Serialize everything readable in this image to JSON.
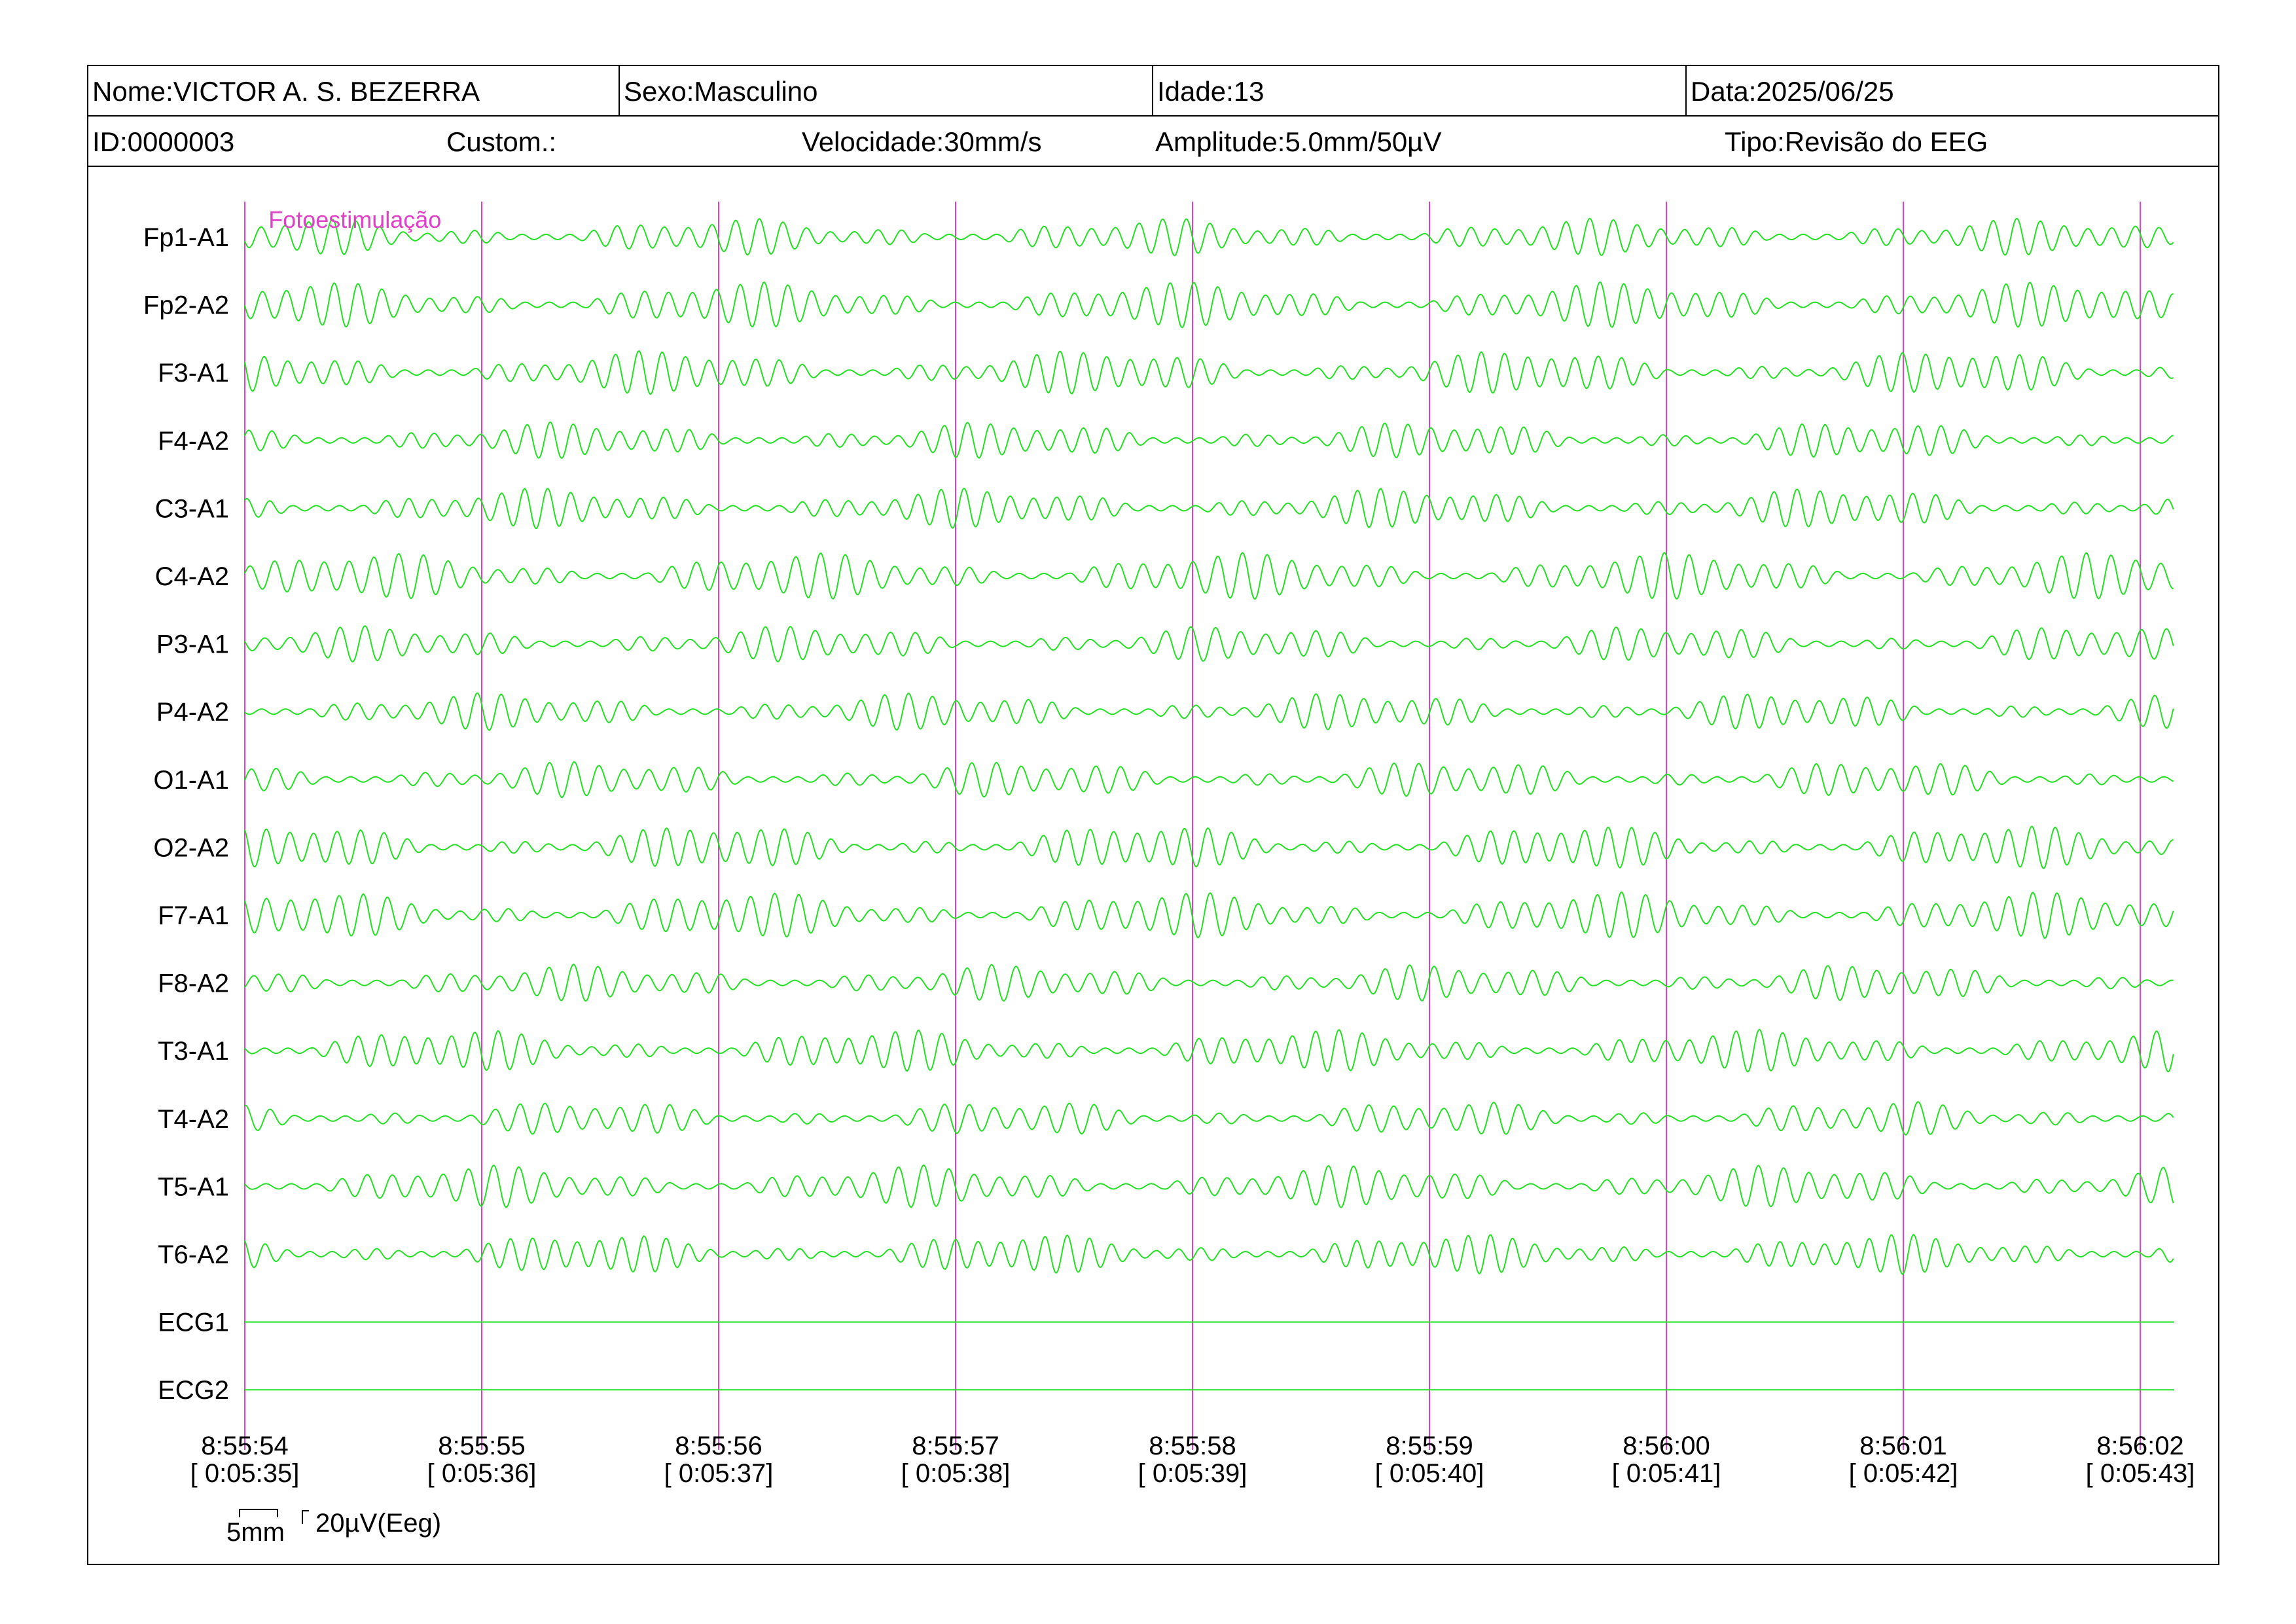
{
  "header": {
    "nome_label": "Nome:",
    "nome_value": "VICTOR A. S. BEZERRA",
    "sexo_label": "Sexo:",
    "sexo_value": "Masculino",
    "idade_label": "Idade:",
    "idade_value": "13",
    "data_label": "Data:",
    "data_value": "2025/06/25",
    "id_label": "ID:",
    "id_value": "0000003",
    "custom_label": "Custom.:",
    "velocidade_label": "Velocidade:",
    "velocidade_value": "30mm/s",
    "amplitude_label": "Amplitude:",
    "amplitude_value": "5.0mm/50µV",
    "tipo_label": "Tipo:",
    "tipo_value": "Revisão do EEG"
  },
  "scale": {
    "time_label": "5mm",
    "amplitude_label": "20µV(Eeg)"
  },
  "colors": {
    "trace": "#22e022",
    "marker_line": "#e040c8",
    "annotation": "#e040c8",
    "border": "#000000"
  },
  "chart_data": {
    "type": "line",
    "x_unit": "s",
    "channels": [
      "Fp1-A1",
      "Fp2-A2",
      "F3-A1",
      "F4-A2",
      "C3-A1",
      "C4-A2",
      "P3-A1",
      "P4-A2",
      "O1-A1",
      "O2-A2",
      "F7-A1",
      "F8-A2",
      "T3-A1",
      "T4-A2",
      "T5-A1",
      "T6-A2",
      "ECG1",
      "ECG2"
    ],
    "flat_channels": [
      "ECG1",
      "ECG2"
    ],
    "dominant_frequency_hz": 10,
    "xlim": [
      0,
      8.15
    ],
    "time_ticks": [
      {
        "t": 0,
        "clock": "8:55:54",
        "elapsed": "[ 0:05:35]"
      },
      {
        "t": 1,
        "clock": "8:55:55",
        "elapsed": "[ 0:05:36]"
      },
      {
        "t": 2,
        "clock": "8:55:56",
        "elapsed": "[ 0:05:37]"
      },
      {
        "t": 3,
        "clock": "8:55:57",
        "elapsed": "[ 0:05:38]"
      },
      {
        "t": 4,
        "clock": "8:55:58",
        "elapsed": "[ 0:05:39]"
      },
      {
        "t": 5,
        "clock": "8:55:59",
        "elapsed": "[ 0:05:40]"
      },
      {
        "t": 6,
        "clock": "8:56:00",
        "elapsed": "[ 0:05:41]"
      },
      {
        "t": 7,
        "clock": "8:56:01",
        "elapsed": "[ 0:05:42]"
      },
      {
        "t": 8,
        "clock": "8:56:02",
        "elapsed": "[ 0:05:43]"
      }
    ],
    "annotations": [
      {
        "t": 0.1,
        "text": "Fotoestimulação"
      }
    ],
    "grid": false
  }
}
